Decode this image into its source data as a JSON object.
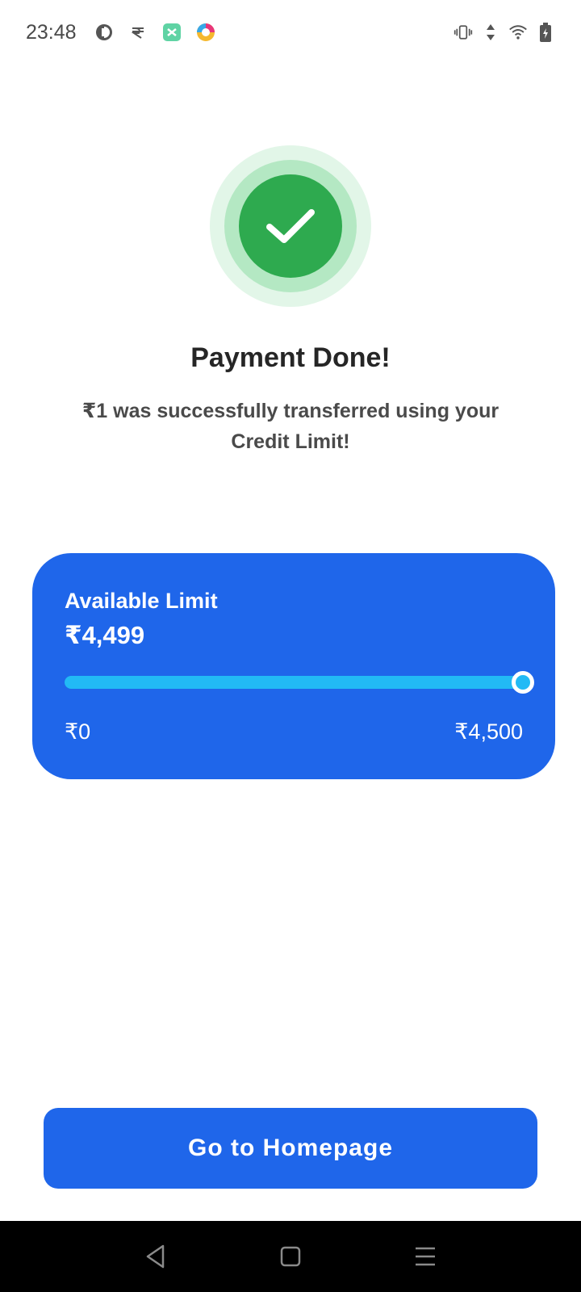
{
  "status_bar": {
    "time": "23:48",
    "left_icons": [
      "pie-app-icon",
      "rupee-app-icon",
      "green-app-icon",
      "color-app-icon"
    ],
    "right_icons": [
      "vibrate-icon",
      "data-arrows-icon",
      "wifi-icon",
      "battery-charging-icon"
    ]
  },
  "success": {
    "icon": "check-icon",
    "title": "Payment Done!",
    "message": "₹1 was successfully transferred using your Credit Limit!"
  },
  "limit_card": {
    "label": "Available Limit",
    "available": "₹4,499",
    "min_label": "₹0",
    "max_label": "₹4,500",
    "available_fraction": 0.9998
  },
  "actions": {
    "homepage_button": "Go to Homepage"
  },
  "colors": {
    "primary": "#1f66ea",
    "success": "#2eaa4f",
    "progress": "#22baf5"
  },
  "nav_bar": {
    "icons": [
      "back-icon",
      "home-icon",
      "recents-icon"
    ]
  }
}
